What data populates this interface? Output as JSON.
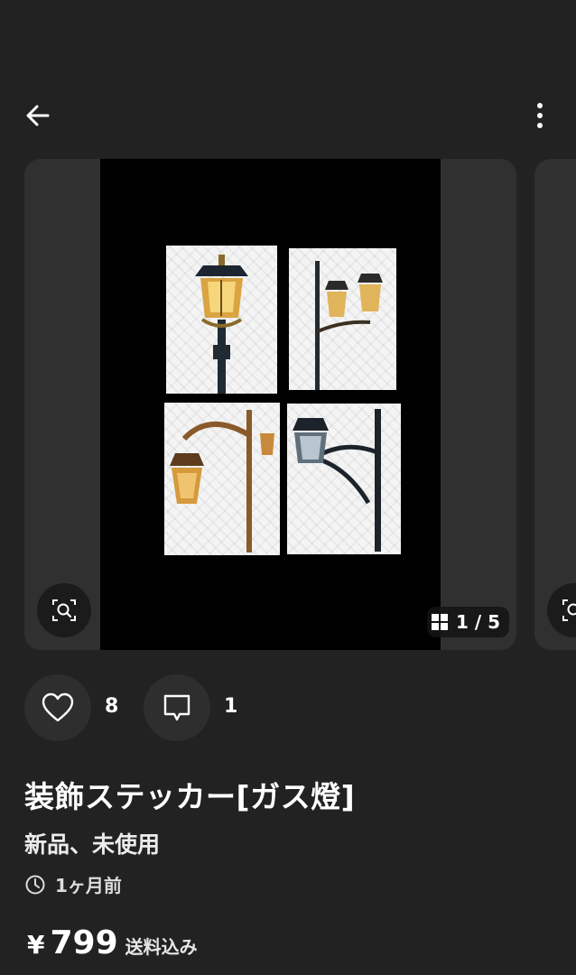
{
  "header": {
    "back_icon": "arrow-left-icon",
    "more_icon": "more-vertical-icon"
  },
  "gallery": {
    "counter_icon": "grid-icon",
    "counter_text": "1 / 5",
    "current_index": 1,
    "total": 5,
    "lens_icon": "image-search-icon"
  },
  "actions": {
    "like_icon": "heart-outline-icon",
    "like_count": "8",
    "comment_icon": "comment-outline-icon",
    "comment_count": "1"
  },
  "item": {
    "title": "装飾ステッカー[ガス燈]",
    "condition": "新品、未使用",
    "time_icon": "clock-icon",
    "posted": "1ヶ月前",
    "currency": "¥",
    "price": "799",
    "shipping": "送料込み"
  },
  "colors": {
    "background": "#222222",
    "card": "#303030",
    "button": "#2e2e2e",
    "text": "#ffffff"
  }
}
